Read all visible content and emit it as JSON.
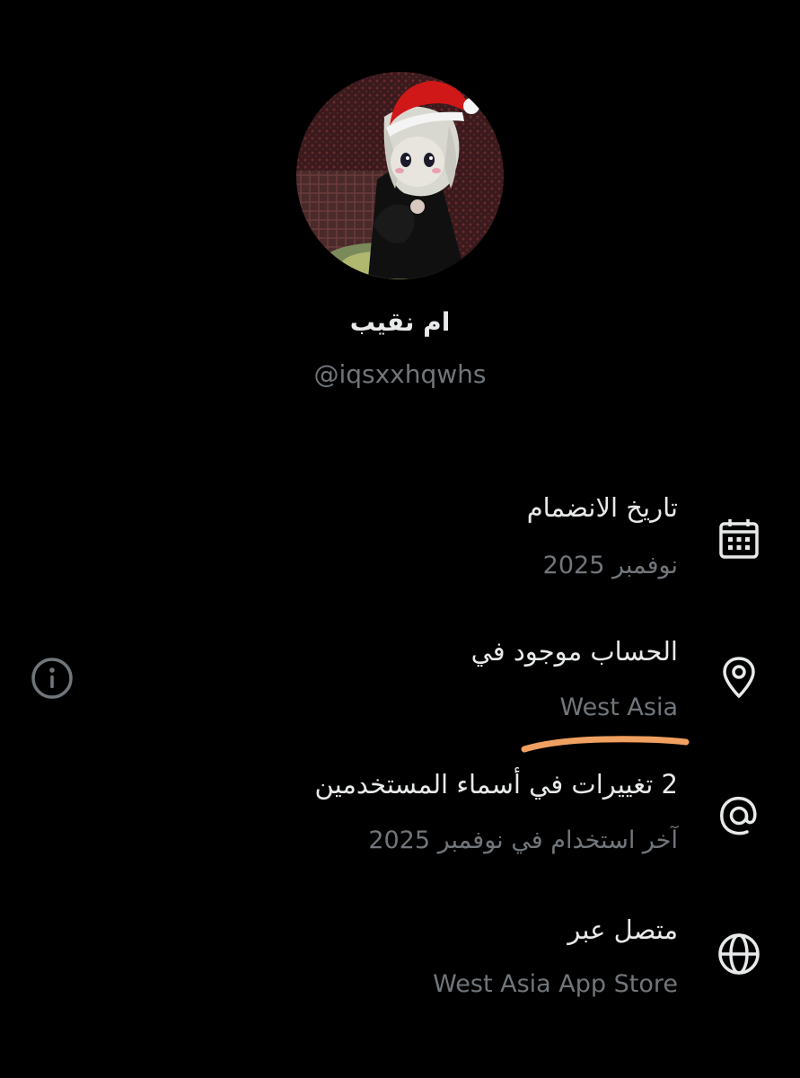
{
  "profile": {
    "display_name": "ام نقيب",
    "handle": "@iqsxxhqwhs"
  },
  "details": {
    "joined": {
      "title": "تاريخ الانضمام",
      "value": "نوفمبر 2025",
      "icon": "calendar-icon"
    },
    "location": {
      "title": "الحساب موجود في",
      "value": "West Asia",
      "icon": "location-pin-icon"
    },
    "username_changes": {
      "title": "2 تغييرات في أسماء المستخدمين",
      "value": "آخر استخدام في نوفمبر 2025",
      "icon": "at-sign-icon"
    },
    "connected_via": {
      "title": "متصل عبر",
      "value": "West Asia App Store",
      "icon": "globe-icon"
    }
  },
  "info_button": {
    "icon": "info-icon"
  },
  "colors": {
    "background": "#000000",
    "primary_text": "#e7e9ea",
    "secondary_text": "#71767b",
    "highlight_stroke": "#f0a060"
  }
}
